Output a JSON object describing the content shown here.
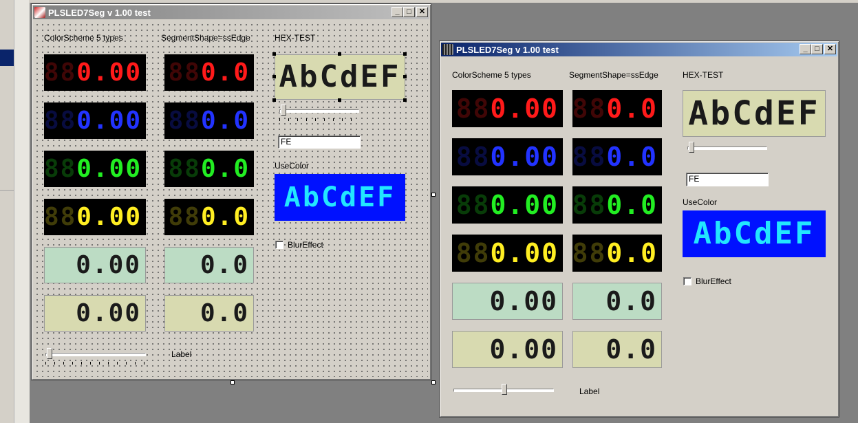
{
  "window_designer": {
    "title": "PLSLED7Seg v 1.00 test",
    "minimize": "_",
    "maximize": "□",
    "close": "✕",
    "colorscheme_label": "ColorScheme 5 types",
    "segshape_label": "SegmentShape=ssEdge",
    "hextest_label": "HEX-TEST",
    "hex_display": "AbCdEF",
    "edit_value": "FE",
    "usecolor_label": "UseColor",
    "usecolor_display": "AbCdEF",
    "blur_label": "BlurEffect",
    "bottom_label": "Label",
    "colorscheme_value": "0.00",
    "colorscheme_ghost": "88",
    "segshape_value": "0.0",
    "segshape_ghost": "88"
  },
  "window_runtime": {
    "title": "PLSLED7Seg v 1.00 test",
    "minimize": "_",
    "maximize": "□",
    "close": "✕",
    "colorscheme_label": "ColorScheme 5 types",
    "segshape_label": "SegmentShape=ssEdge",
    "hextest_label": "HEX-TEST",
    "hex_display": "AbCdEF",
    "edit_value": "FE",
    "usecolor_label": "UseColor",
    "usecolor_display": "AbCdEF",
    "blur_label": "BlurEffect",
    "bottom_label": "Label",
    "colorscheme_value": "0.00",
    "colorscheme_ghost": "88",
    "segshape_value": "0.0",
    "segshape_ghost": "88"
  },
  "colors": {
    "red": "#ff1a1a",
    "blue": "#2233ff",
    "green": "#22ee22",
    "yellow": "#ffee22",
    "lcd_green_bg": "#bcdcc4",
    "lcd_beige_bg": "#d8dab0",
    "lcd_text": "#1a1a1a",
    "usecolor_bg": "#0011ff",
    "usecolor_text": "#22e6ff"
  }
}
